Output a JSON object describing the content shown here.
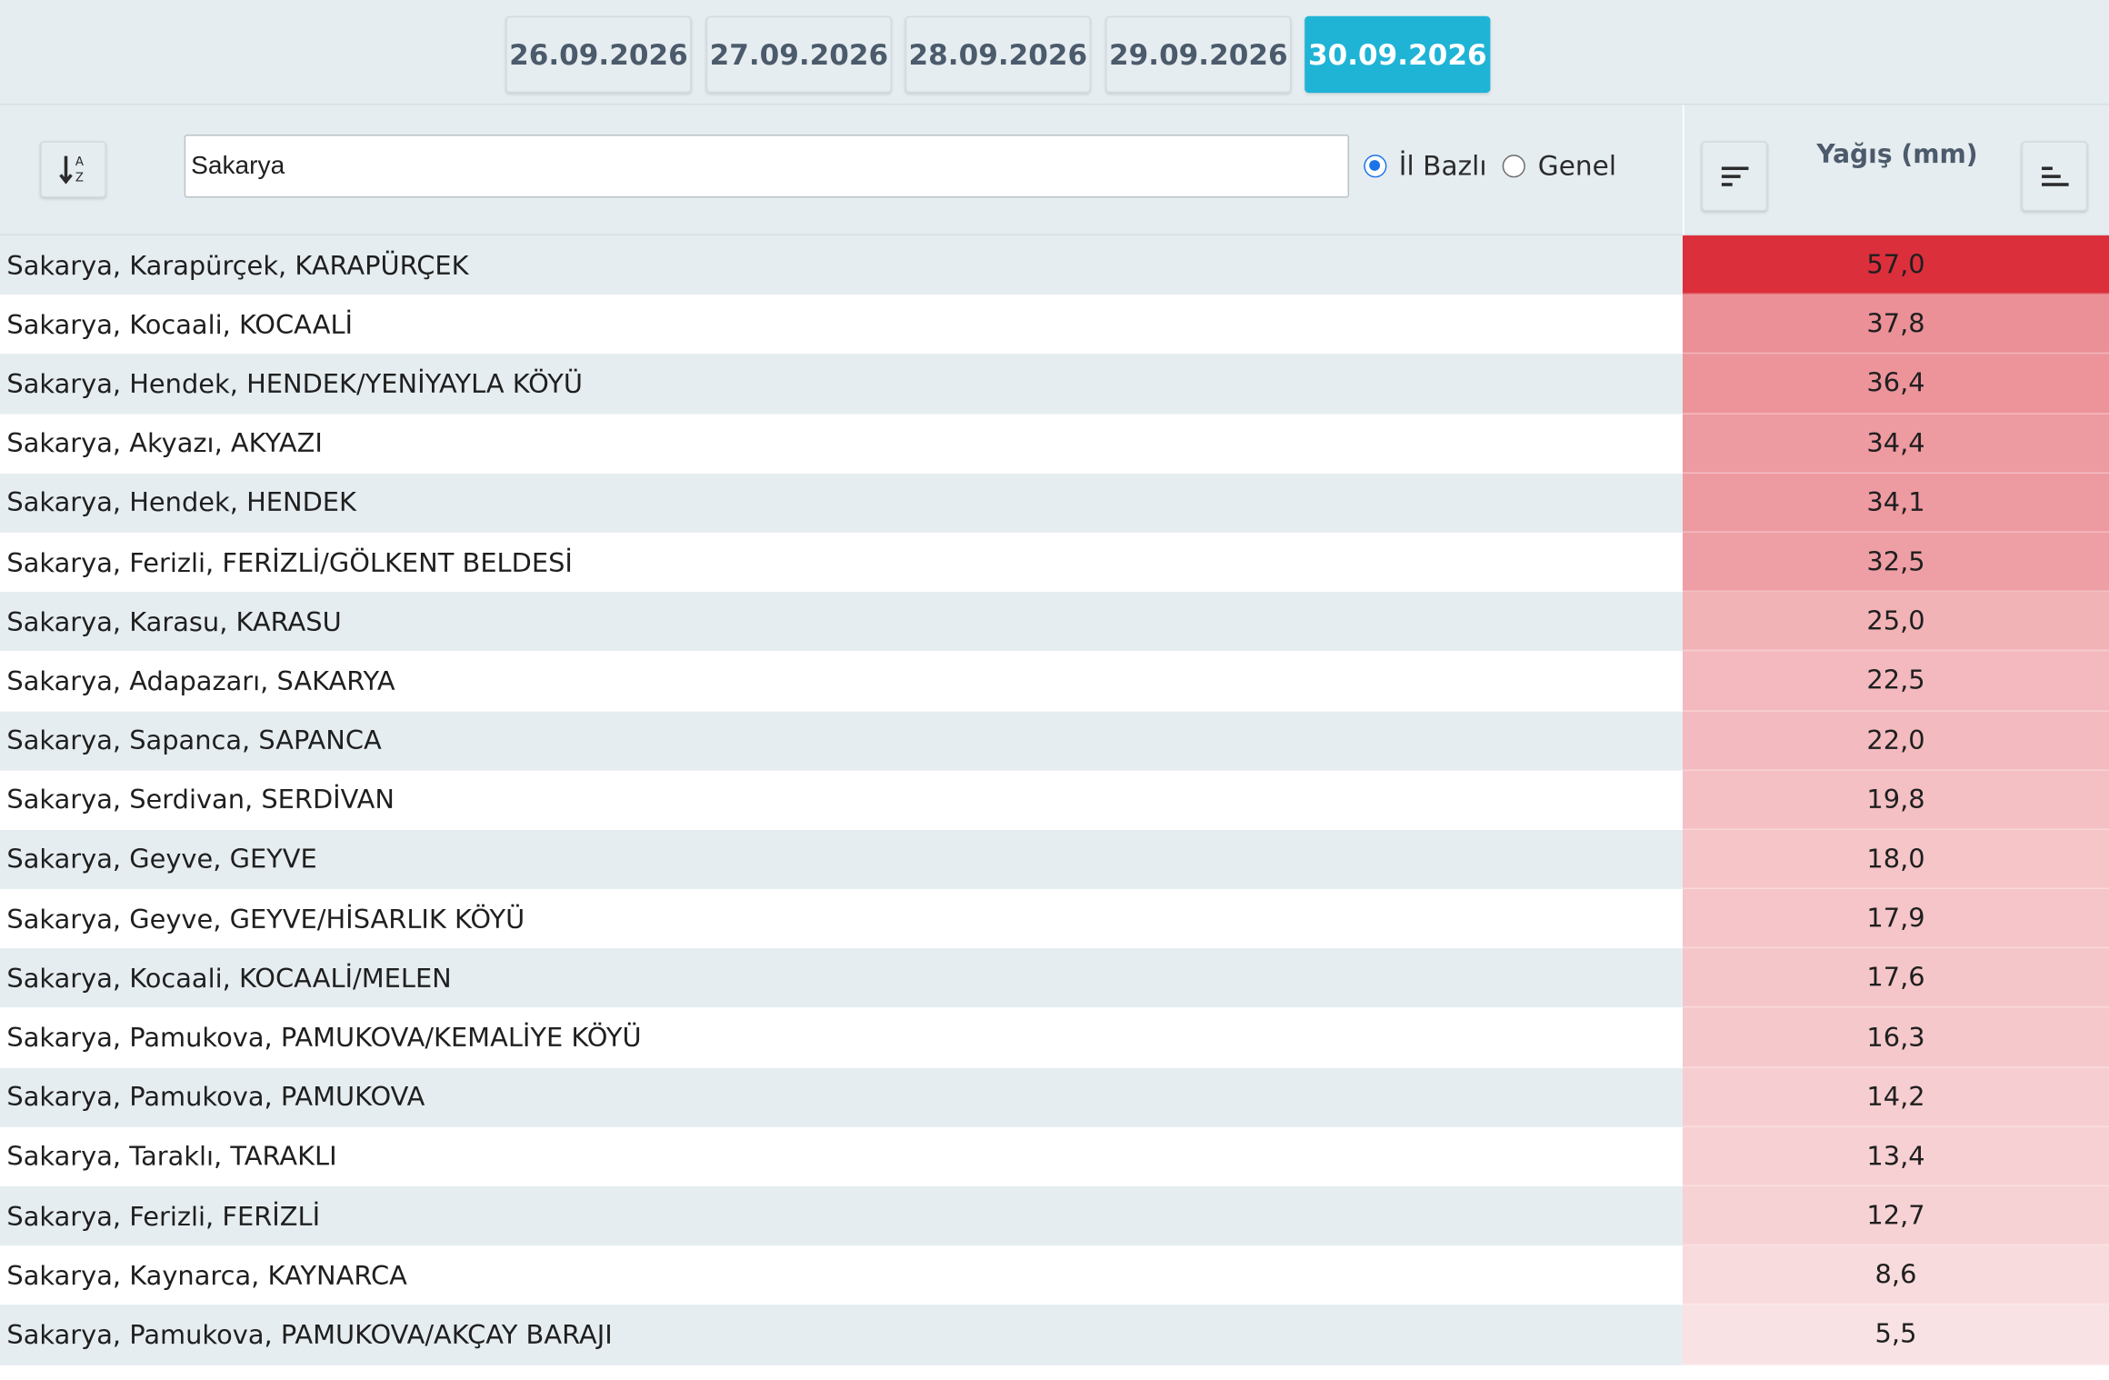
{
  "date_tabs": [
    {
      "label": "26.09.2026",
      "active": false
    },
    {
      "label": "27.09.2026",
      "active": false
    },
    {
      "label": "28.09.2026",
      "active": false
    },
    {
      "label": "29.09.2026",
      "active": false
    },
    {
      "label": "30.09.2026",
      "active": true
    }
  ],
  "filter": {
    "search_value": "Sakarya",
    "radio_options": [
      {
        "label": "İl Bazlı",
        "checked": true
      },
      {
        "label": "Genel",
        "checked": false
      }
    ]
  },
  "value_column": {
    "title": "Yağış (mm)"
  },
  "colors": {
    "accent": "#1fb4d6",
    "heat_max": "#dc2f3c"
  },
  "rows": [
    {
      "name": "Sakarya, Karapürçek, KARAPÜRÇEK",
      "value": "57,0",
      "num": 57.0
    },
    {
      "name": "Sakarya, Kocaali, KOCAALİ",
      "value": "37,8",
      "num": 37.8
    },
    {
      "name": "Sakarya, Hendek, HENDEK/YENİYAYLA KÖYÜ",
      "value": "36,4",
      "num": 36.4
    },
    {
      "name": "Sakarya, Akyazı, AKYAZI",
      "value": "34,4",
      "num": 34.4
    },
    {
      "name": "Sakarya, Hendek, HENDEK",
      "value": "34,1",
      "num": 34.1
    },
    {
      "name": "Sakarya, Ferizli, FERİZLİ/GÖLKENT BELDESİ",
      "value": "32,5",
      "num": 32.5
    },
    {
      "name": "Sakarya, Karasu, KARASU",
      "value": "25,0",
      "num": 25.0
    },
    {
      "name": "Sakarya, Adapazarı, SAKARYA",
      "value": "22,5",
      "num": 22.5
    },
    {
      "name": "Sakarya, Sapanca, SAPANCA",
      "value": "22,0",
      "num": 22.0
    },
    {
      "name": "Sakarya, Serdivan, SERDİVAN",
      "value": "19,8",
      "num": 19.8
    },
    {
      "name": "Sakarya, Geyve, GEYVE",
      "value": "18,0",
      "num": 18.0
    },
    {
      "name": "Sakarya, Geyve, GEYVE/HİSARLIK KÖYÜ",
      "value": "17,9",
      "num": 17.9
    },
    {
      "name": "Sakarya, Kocaali, KOCAALİ/MELEN",
      "value": "17,6",
      "num": 17.6
    },
    {
      "name": "Sakarya, Pamukova, PAMUKOVA/KEMALİYE KÖYÜ",
      "value": "16,3",
      "num": 16.3
    },
    {
      "name": "Sakarya, Pamukova, PAMUKOVA",
      "value": "14,2",
      "num": 14.2
    },
    {
      "name": "Sakarya, Taraklı, TARAKLI",
      "value": "13,4",
      "num": 13.4
    },
    {
      "name": "Sakarya, Ferizli, FERİZLİ",
      "value": "12,7",
      "num": 12.7
    },
    {
      "name": "Sakarya, Kaynarca, KAYNARCA",
      "value": "8,6",
      "num": 8.6
    },
    {
      "name": "Sakarya, Pamukova, PAMUKOVA/AKÇAY BARAJI",
      "value": "5,5",
      "num": 5.5
    }
  ]
}
